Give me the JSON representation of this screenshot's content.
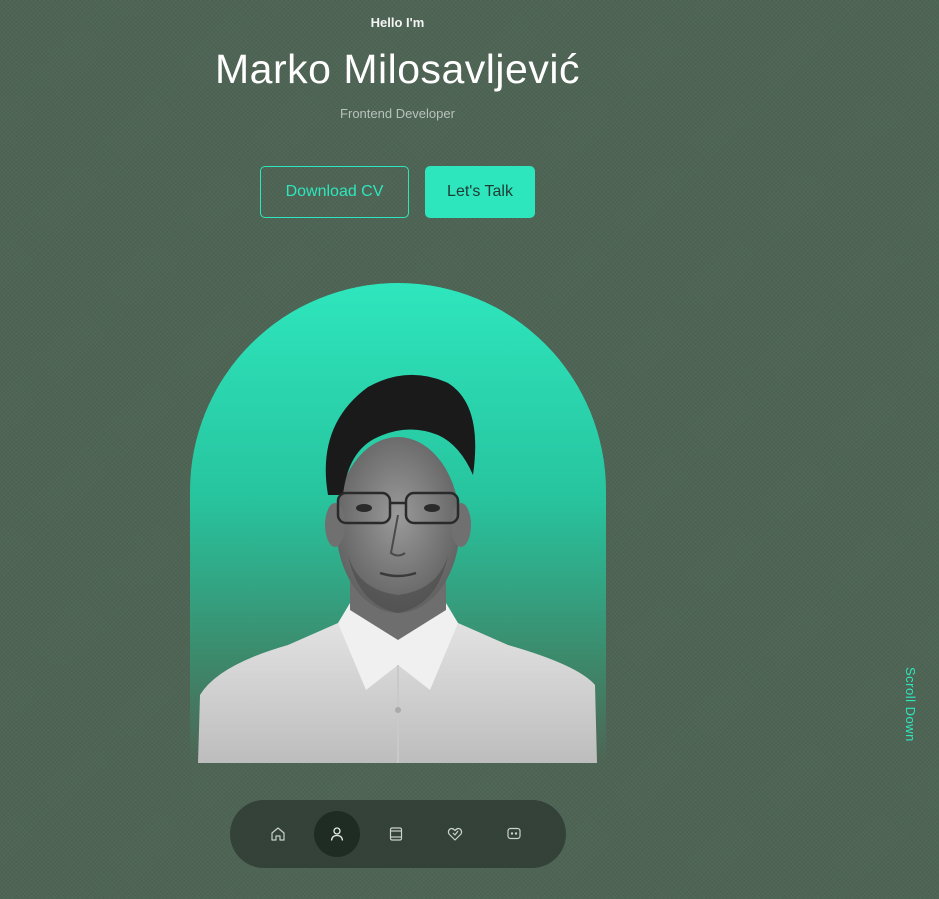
{
  "hero": {
    "greeting": "Hello I'm",
    "name": "Marko Milosavljević",
    "role": "Frontend Developer"
  },
  "buttons": {
    "download_cv": "Download CV",
    "lets_talk": "Let's Talk"
  },
  "scroll_down": "Scroll Down",
  "nav": {
    "items": [
      {
        "icon": "home-icon",
        "active": false
      },
      {
        "icon": "user-icon",
        "active": true
      },
      {
        "icon": "book-icon",
        "active": false
      },
      {
        "icon": "services-icon",
        "active": false
      },
      {
        "icon": "message-icon",
        "active": false
      }
    ]
  },
  "colors": {
    "accent": "#2ee6bd",
    "background": "#4e6454",
    "nav_bg": "#2a342e"
  }
}
